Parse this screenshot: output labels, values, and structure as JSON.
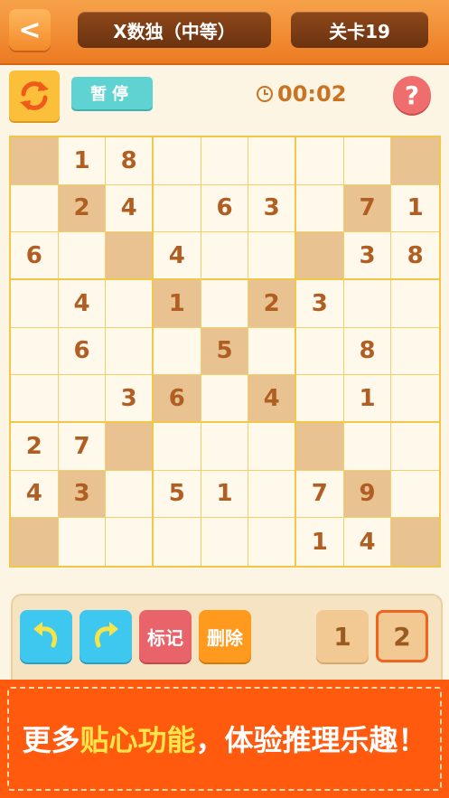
{
  "header": {
    "back_glyph": "<",
    "title": "X数独（中等）",
    "level": "关卡19"
  },
  "toolbar": {
    "pause_label": "暂停",
    "timer": "00:02",
    "help_glyph": "?"
  },
  "board": {
    "cells": [
      [
        "",
        "1",
        "8",
        "",
        "",
        "",
        "",
        "",
        ""
      ],
      [
        "",
        "2",
        "4",
        "",
        "6",
        "3",
        "",
        "7",
        "1"
      ],
      [
        "6",
        "",
        "",
        "4",
        "",
        "",
        "",
        "3",
        "8"
      ],
      [
        "",
        "4",
        "",
        "1",
        "",
        "2",
        "3",
        "",
        ""
      ],
      [
        "",
        "6",
        "",
        "",
        "5",
        "",
        "",
        "8",
        ""
      ],
      [
        "",
        "",
        "3",
        "6",
        "",
        "4",
        "",
        "1",
        ""
      ],
      [
        "2",
        "7",
        "",
        "",
        "",
        "",
        "",
        "",
        ""
      ],
      [
        "4",
        "3",
        "",
        "5",
        "1",
        "",
        "7",
        "9",
        ""
      ],
      [
        "",
        "",
        "",
        "",
        "",
        "",
        "1",
        "4",
        ""
      ]
    ]
  },
  "controls": {
    "mark_label": "标记",
    "delete_label": "删除",
    "numbers": [
      "1",
      "2"
    ]
  },
  "banner": {
    "text_a": "更多",
    "text_highlight": "贴心功能",
    "text_b": "，体验推理乐趣！"
  },
  "colors": {
    "header": "#ec7b22",
    "diagonal": "#e8c391",
    "digit": "#b15e22",
    "banner": "#ff5a0e",
    "highlight": "#ffe44a"
  }
}
